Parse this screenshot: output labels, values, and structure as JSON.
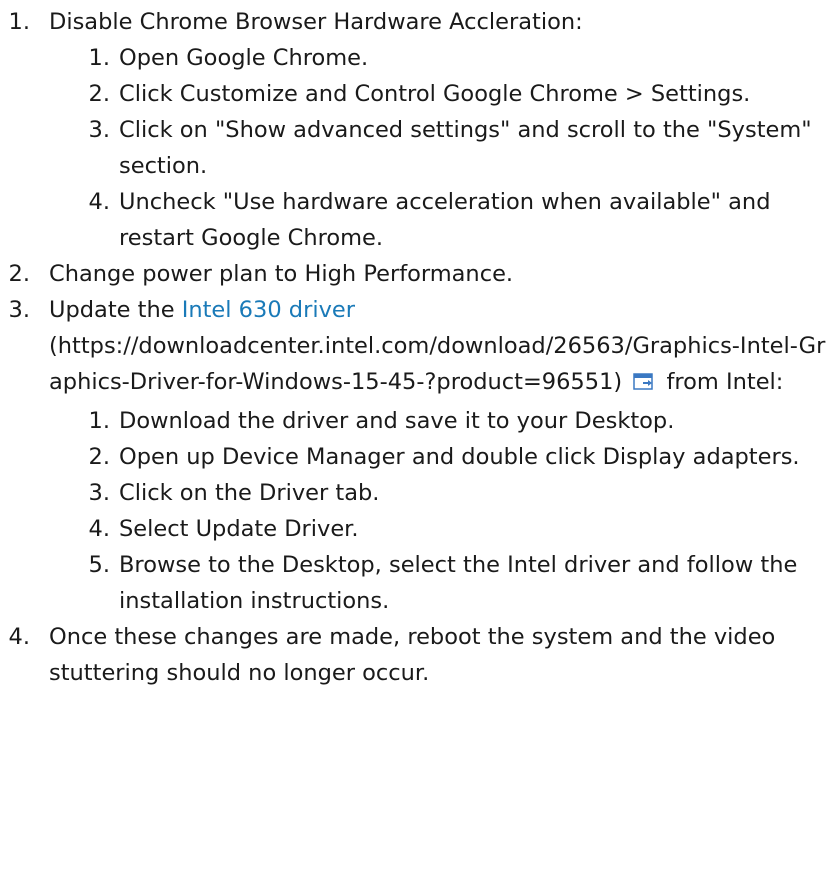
{
  "steps": [
    {
      "num": "1.",
      "text": "Disable Chrome Browser Hardware Accleration:",
      "substeps": [
        {
          "num": "1.",
          "text": "Open Google Chrome."
        },
        {
          "num": "2.",
          "text": "Click Customize and Control Google Chrome > Settings."
        },
        {
          "num": "3.",
          "text": "Click on \"Show advanced settings\" and scroll to the \"System\" section."
        },
        {
          "num": "4.",
          "text": "Uncheck \"Use hardware acceleration when available\" and restart Google Chrome."
        }
      ]
    },
    {
      "num": "2.",
      "text": "Change power plan to High Performance."
    },
    {
      "num": "3.",
      "text_before": "Update the ",
      "link_text": "Intel 630 driver",
      "link_url_text": "(https://downloadcenter.intel.com/download/26563/Graphics-Intel-Graphics-Driver-for-Windows-15-45-?product=96551)",
      "text_after": " from Intel:",
      "icon": "external-link-icon",
      "substeps": [
        {
          "num": "1.",
          "text": "Download the driver and save it to your Desktop."
        },
        {
          "num": "2.",
          "text": "Open up Device Manager and double click Display adapters."
        },
        {
          "num": "3.",
          "text": "Click on the Driver tab."
        },
        {
          "num": "4.",
          "text": "Select Update Driver."
        },
        {
          "num": "5.",
          "text": "Browse to the Desktop, select the Intel driver and follow the installation instructions."
        }
      ]
    },
    {
      "num": "4.",
      "text": "Once these changes are made, reboot the system and the video stuttering should no longer occur."
    }
  ],
  "colors": {
    "text": "#1a1a1a",
    "link": "#1a7ab8"
  }
}
